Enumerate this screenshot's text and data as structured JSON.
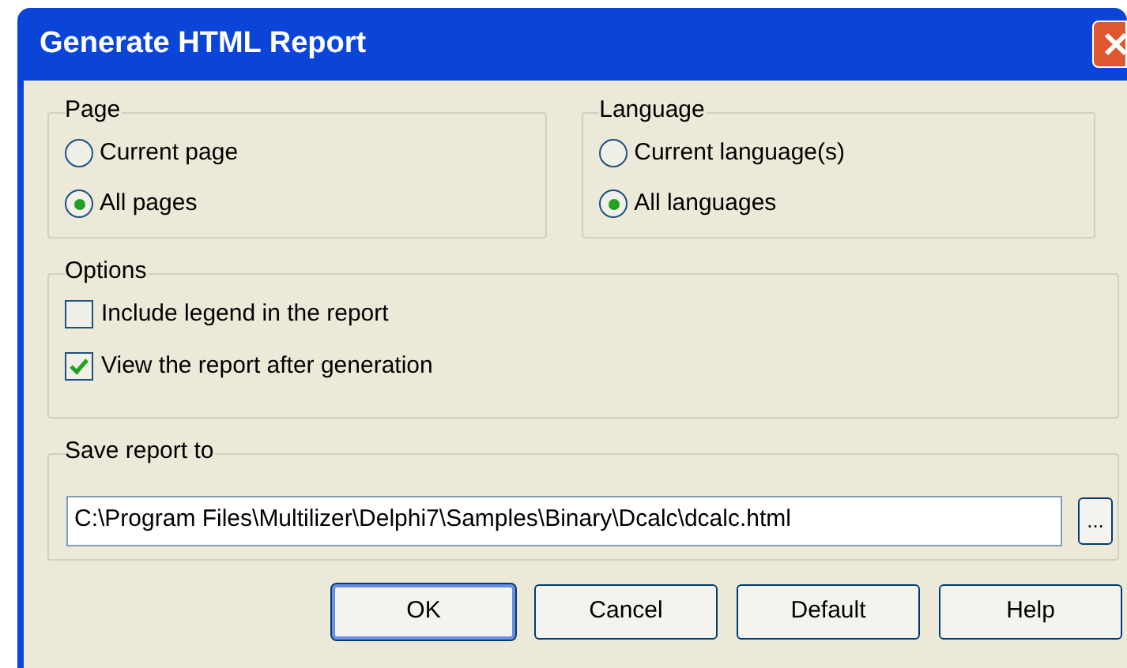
{
  "window": {
    "title": "Generate HTML Report"
  },
  "page_group": {
    "title": "Page",
    "options": [
      {
        "label": "Current page",
        "selected": false
      },
      {
        "label": "All pages",
        "selected": true
      }
    ]
  },
  "language_group": {
    "title": "Language",
    "options": [
      {
        "label": "Current language(s)",
        "selected": false
      },
      {
        "label": "All languages",
        "selected": true
      }
    ]
  },
  "options_group": {
    "title": "Options",
    "checkboxes": [
      {
        "label": "Include legend in the report",
        "checked": false
      },
      {
        "label": "View the report after generation",
        "checked": true
      }
    ]
  },
  "save_group": {
    "title": "Save report to",
    "path": "C:\\Program Files\\Multilizer\\Delphi7\\Samples\\Binary\\Dcalc\\dcalc.html",
    "browse_label": "..."
  },
  "buttons": [
    {
      "label": "OK",
      "default": true
    },
    {
      "label": "Cancel",
      "default": false
    },
    {
      "label": "Default",
      "default": false
    },
    {
      "label": "Help",
      "default": false
    }
  ]
}
